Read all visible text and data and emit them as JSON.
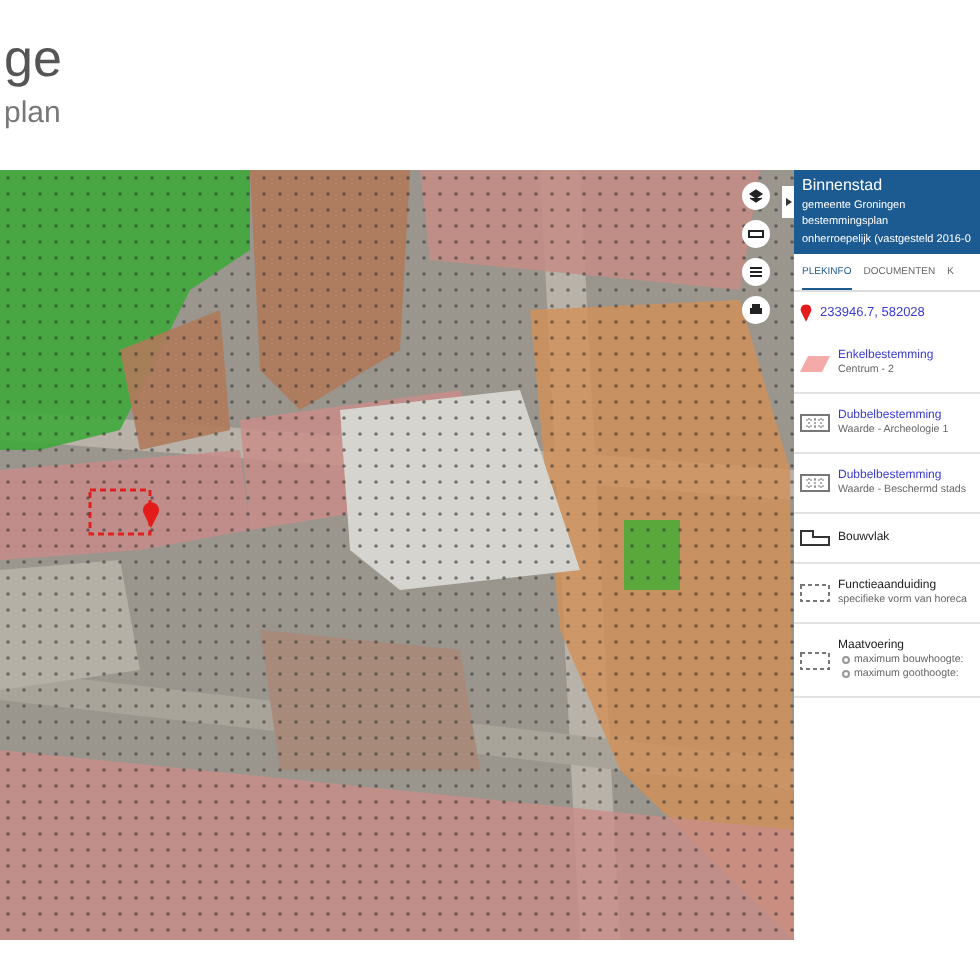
{
  "header": {
    "title": "ge",
    "subtitle": "plan"
  },
  "panel": {
    "lines": [
      "Binnenstad",
      "gemeente Groningen",
      "bestemmingsplan",
      "onherroepelijk (vastgesteld 2016-0"
    ],
    "tabs": [
      {
        "label": "PLEKINFO",
        "selected": true
      },
      {
        "label": "DOCUMENTEN",
        "selected": false
      },
      {
        "label": "K",
        "selected": false
      }
    ],
    "location": "233946.7, 582028",
    "items": [
      {
        "kind": "enkel",
        "title": "Enkelbestemming",
        "lines": [
          "Centrum - 2"
        ]
      },
      {
        "kind": "dubbel",
        "title": "Dubbelbestemming",
        "lines": [
          "Waarde - Archeologie 1"
        ]
      },
      {
        "kind": "dubbel",
        "title": "Dubbelbestemming",
        "lines": [
          "Waarde - Beschermd stads"
        ]
      },
      {
        "kind": "bouwvlak",
        "title": "Bouwvlak"
      },
      {
        "kind": "functie",
        "title": "Functieaanduiding",
        "lines": [
          "specifieke vorm van horeca"
        ]
      },
      {
        "kind": "maatvoering",
        "title": "Maatvoering",
        "bullets": [
          "maximum bouwhoogte:",
          "maximum goothoogte:"
        ]
      }
    ]
  }
}
